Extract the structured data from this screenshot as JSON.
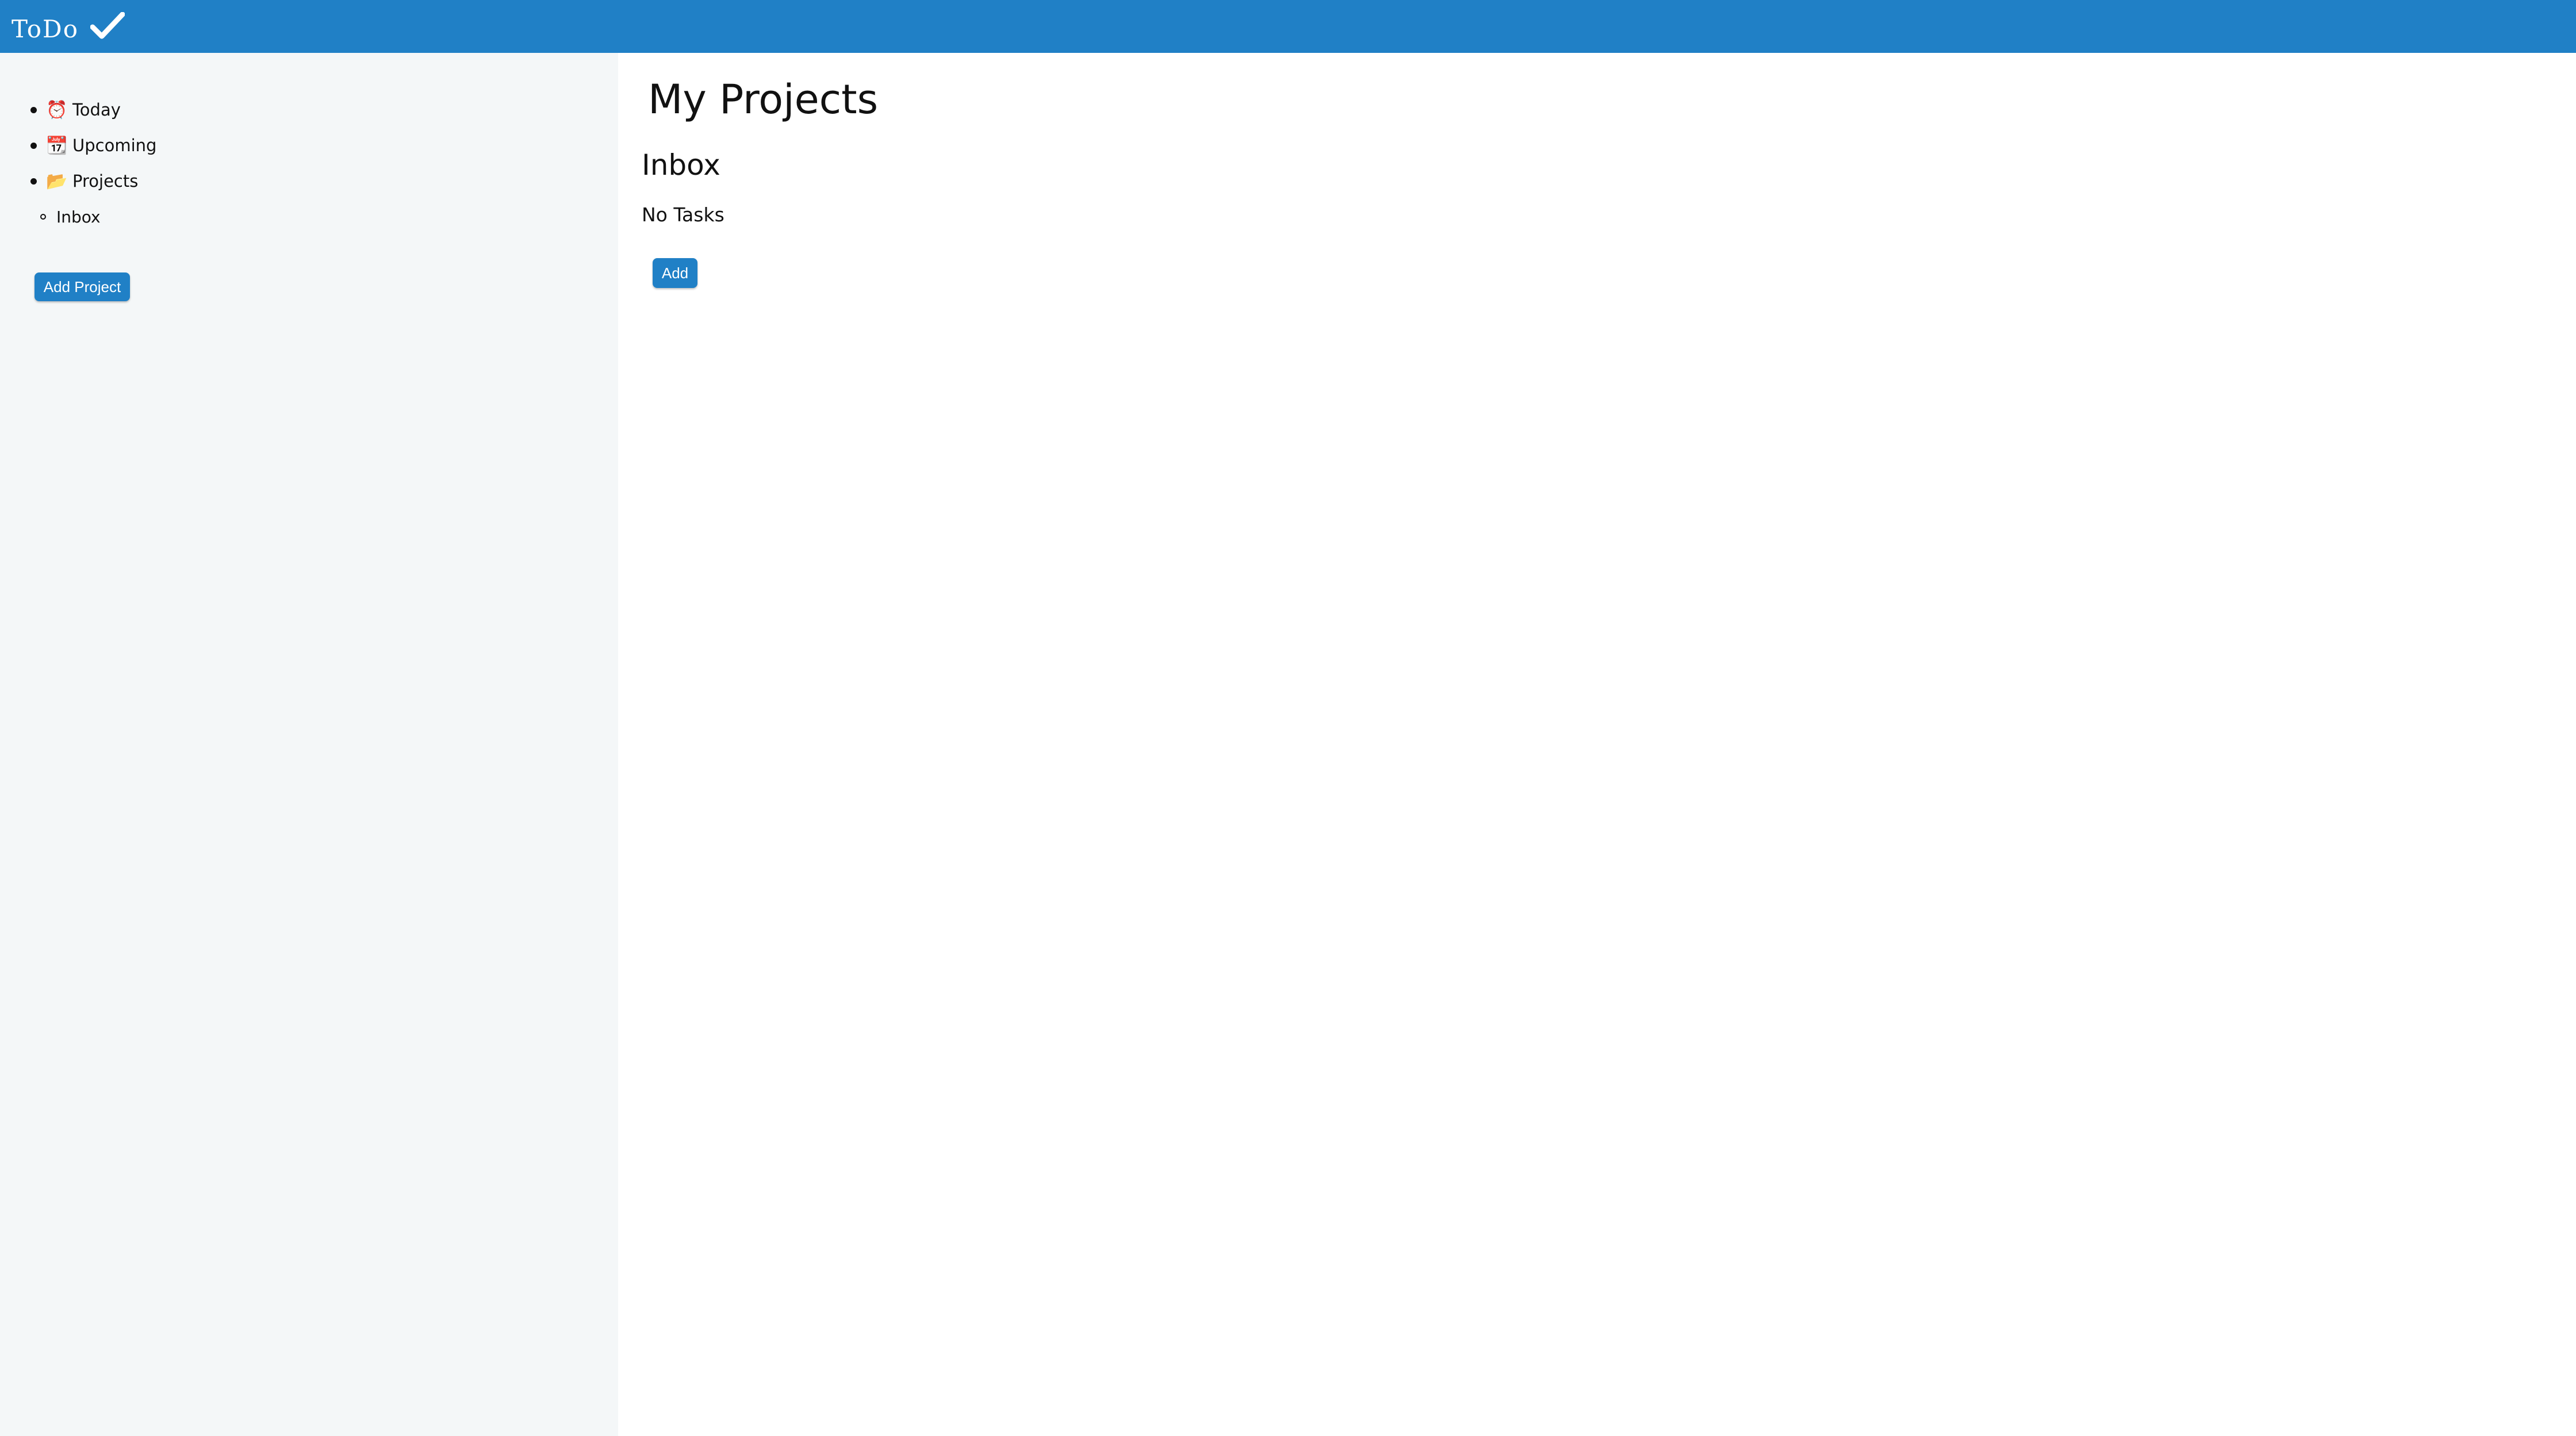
{
  "header": {
    "logo_text": "ToDo",
    "logo_icon": "checkmark-icon",
    "color": "#2080c6"
  },
  "sidebar": {
    "items": [
      {
        "label": "Today",
        "icon": "alarm-clock-icon",
        "glyph": "⏰"
      },
      {
        "label": "Upcoming",
        "icon": "calendar-icon",
        "glyph": "📆"
      },
      {
        "label": "Projects",
        "icon": "folder-icon",
        "glyph": "📂"
      }
    ],
    "projects": [
      {
        "label": "Inbox"
      }
    ],
    "add_project_label": "Add Project"
  },
  "main": {
    "title": "My Projects",
    "project_title": "Inbox",
    "empty_text": "No Tasks",
    "add_label": "Add"
  }
}
